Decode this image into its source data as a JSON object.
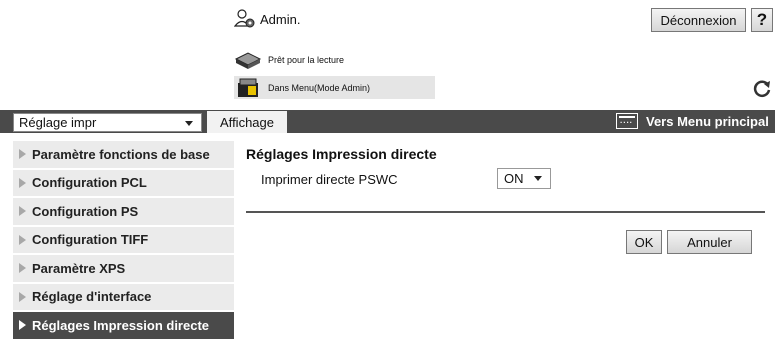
{
  "header": {
    "admin_label": "Admin.",
    "logout_label": "Déconnexion",
    "help_label": "?"
  },
  "status": {
    "line1": "Prêt pour la lecture",
    "line2": "Dans Menu(Mode Admin)"
  },
  "toolbar": {
    "category_select": "Réglage impr",
    "view_tab": "Affichage",
    "main_menu_link": "Vers Menu principal"
  },
  "sidebar": {
    "items": [
      {
        "label": "Paramètre fonctions de base",
        "active": false
      },
      {
        "label": "Configuration PCL",
        "active": false
      },
      {
        "label": "Configuration PS",
        "active": false
      },
      {
        "label": "Configuration TIFF",
        "active": false
      },
      {
        "label": "Paramètre XPS",
        "active": false
      },
      {
        "label": "Réglage d'interface",
        "active": false
      },
      {
        "label": "Réglages Impression directe",
        "active": true
      }
    ]
  },
  "main": {
    "title": "Réglages Impression directe",
    "setting_label": "Imprimer directe PSWC",
    "setting_value": "ON",
    "ok_label": "OK",
    "cancel_label": "Annuler"
  },
  "colors": {
    "bar": "#4a4a4a",
    "sidebar_item": "#ebebeb",
    "status_highlight": "#e5e5e5"
  }
}
